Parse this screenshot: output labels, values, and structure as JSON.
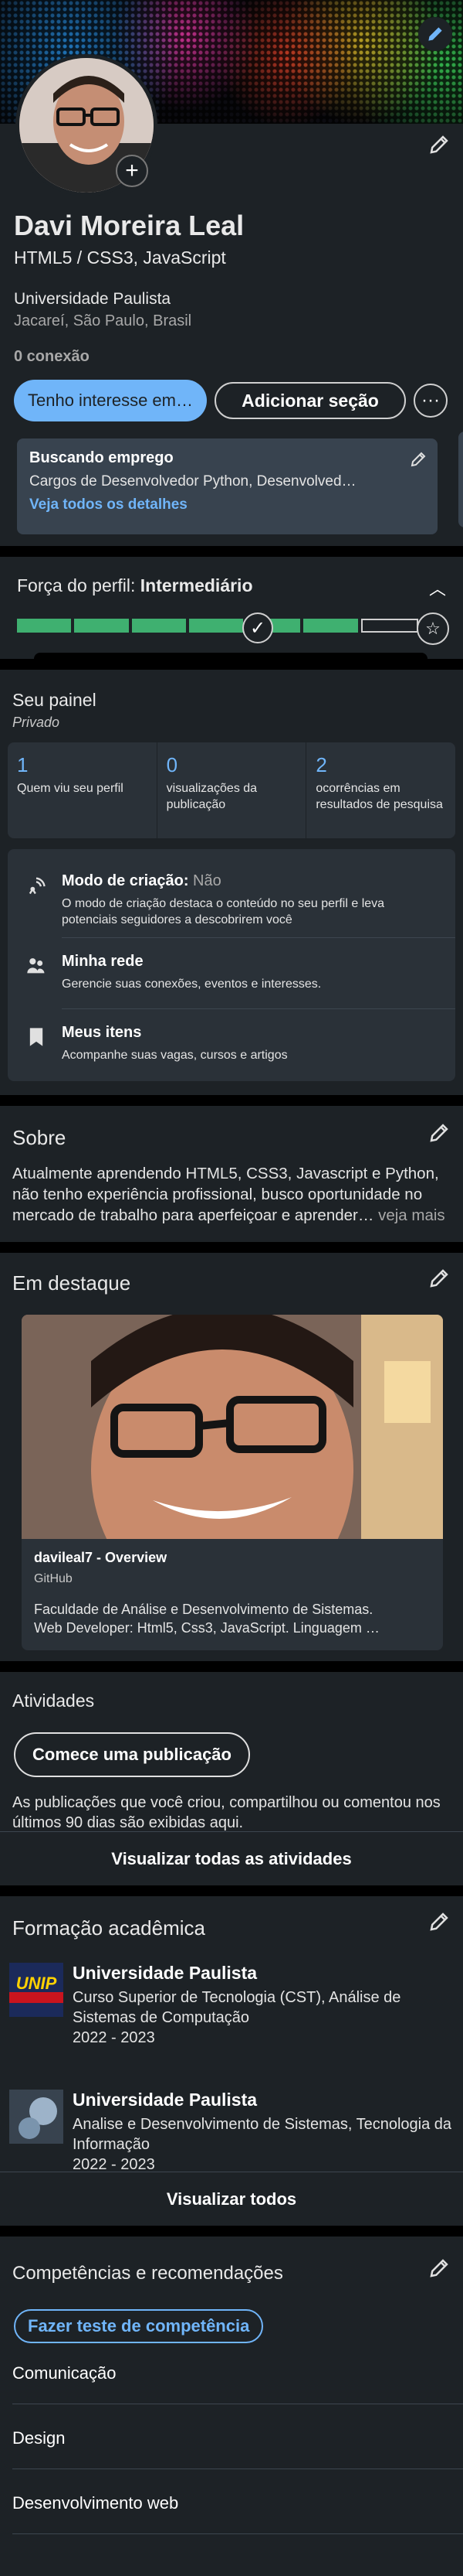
{
  "profile": {
    "name": "Davi Moreira Leal",
    "headline": "HTML5 / CSS3, JavaScript",
    "school": "Universidade Paulista",
    "location": "Jacareí, São Paulo, Brasil",
    "connections": "0 conexão",
    "btn_open_to": "Tenho interesse em…",
    "btn_add_section": "Adicionar seção",
    "btn_more": "···",
    "open_to_work": {
      "title": "Buscando emprego",
      "desc": "Cargos de Desenvolvedor Python, Desenvolved…",
      "link": "Veja todos os detalhes"
    }
  },
  "strength": {
    "label": "Força do perfil:",
    "level": "Intermediário",
    "progress_percent": 85
  },
  "panel": {
    "title": "Seu painel",
    "privacy": "Privado",
    "stats": [
      {
        "value": "1",
        "label": "Quem viu seu perfil"
      },
      {
        "value": "0",
        "label": "visualizações da publicação"
      },
      {
        "value": "2",
        "label": "ocorrências em resultados de pesquisa"
      }
    ],
    "tools": [
      {
        "title": "Modo de criação:",
        "status": "Não",
        "desc": "O modo de criação destaca o conteúdo no seu perfil e leva potenciais seguidores a descobrirem você",
        "icon": "broadcast-icon"
      },
      {
        "title": "Minha rede",
        "status": "",
        "desc": "Gerencie suas conexões, eventos e interesses.",
        "icon": "people-icon"
      },
      {
        "title": "Meus itens",
        "status": "",
        "desc": "Acompanhe suas vagas, cursos e artigos",
        "icon": "bookmark-icon"
      }
    ]
  },
  "about": {
    "title": "Sobre",
    "text": "Atualmente aprendendo HTML5, CSS3, Javascript e Python, não tenho experiência profissional, busco oportunidade no mercado de trabalho para aperfeiçoar e aprender…",
    "more": " veja mais"
  },
  "featured": {
    "title": "Em destaque",
    "card_title": "davileal7 - Overview",
    "card_source": "GitHub",
    "card_desc_1": "Faculdade de Análise e Desenvolvimento de Sistemas.",
    "card_desc_2": "Web Developer: Html5, Css3, JavaScript. Linguagem …"
  },
  "activity": {
    "title": "Atividades",
    "button": "Comece uma publicação",
    "desc": "As publicações que você criou, compartilhou ou comentou nos últimos 90 dias são exibidas aqui.",
    "show_all": "Visualizar todas as atividades"
  },
  "education": {
    "title": "Formação acadêmica",
    "items": [
      {
        "school": "Universidade Paulista",
        "course": "Curso Superior de Tecnologia (CST), Análise de Sistemas de Computação",
        "years": "2022 - 2023",
        "logo": "UNIP"
      },
      {
        "school": "Universidade Paulista",
        "course": "Analise e Desenvolvimento de Sistemas, Tecnologia da Informação",
        "years": "2022 - 2023",
        "logo": ""
      }
    ],
    "show_all": "Visualizar todos"
  },
  "skills": {
    "title": "Competências e recomendações",
    "test_button": "Fazer teste de competência",
    "items": [
      "Comunicação",
      "Design",
      "Desenvolvimento web"
    ]
  },
  "colors": {
    "accent": "#70b5f9",
    "card_bg": "#1d2226",
    "progress": "#3fb070"
  }
}
